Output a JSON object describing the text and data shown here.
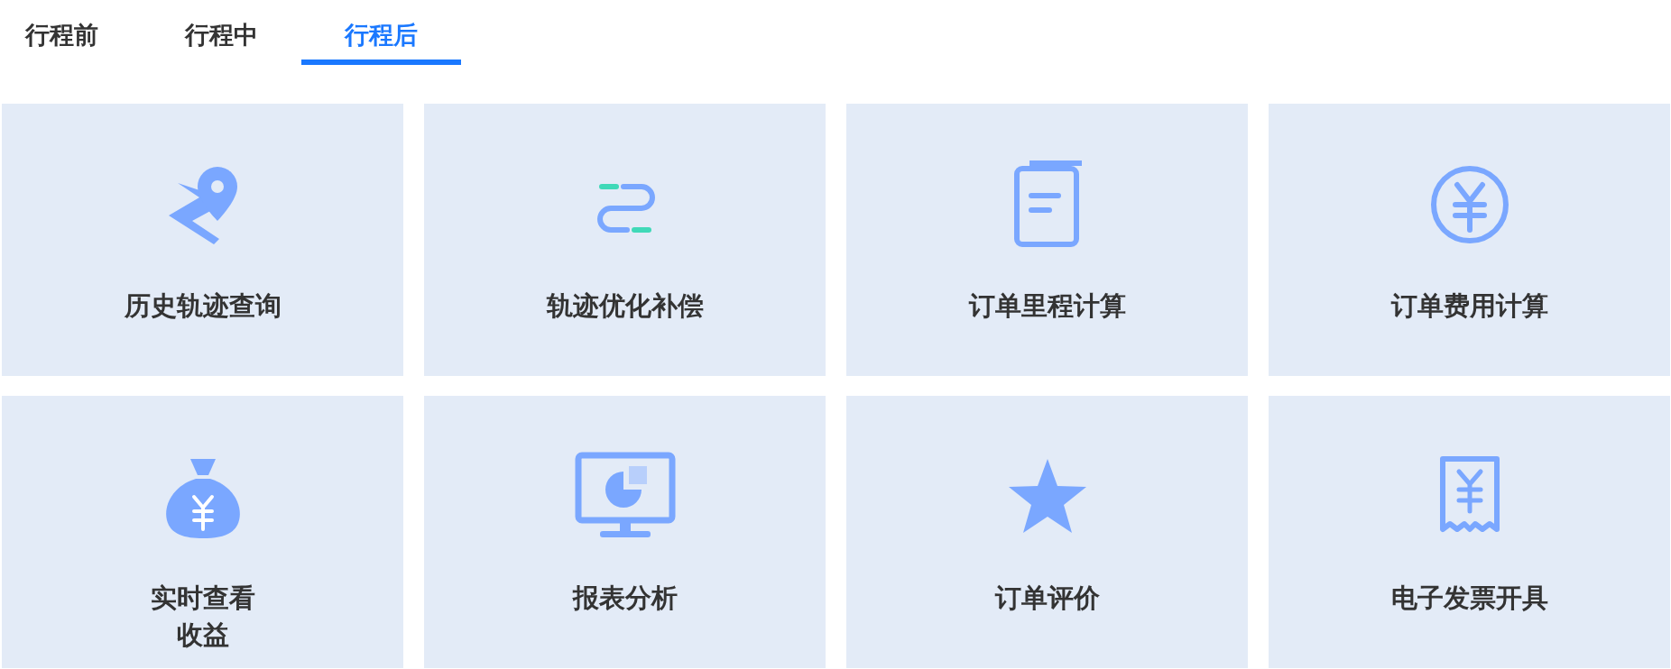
{
  "tabs": [
    {
      "label": "行程前",
      "selected": false
    },
    {
      "label": "行程中",
      "selected": false
    },
    {
      "label": "行程后",
      "selected": true
    }
  ],
  "cards": [
    {
      "lines": [
        "历史轨迹查询"
      ]
    },
    {
      "lines": [
        "轨迹优化补偿"
      ]
    },
    {
      "lines": [
        "订单里程计算"
      ]
    },
    {
      "lines": [
        "订单费用计算"
      ]
    },
    {
      "lines": [
        "实时查看",
        "收益"
      ]
    },
    {
      "lines": [
        "报表分析"
      ]
    },
    {
      "lines": [
        "订单评价"
      ]
    },
    {
      "lines": [
        "电子发票开具"
      ]
    }
  ]
}
